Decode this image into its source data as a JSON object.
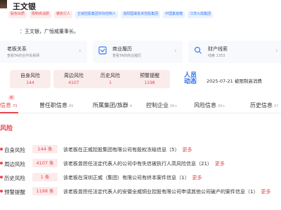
{
  "header": {
    "name": "王文银",
    "tags": [
      {
        "label": "股权出质",
        "style": "red"
      },
      {
        "label": "限制高消费",
        "style": "red"
      },
      {
        "label": "被执行人",
        "style": "red"
      },
      {
        "label": "正威控股集团实际控制人",
        "style": "blue"
      },
      {
        "label": "洛阳国晟投资控股集团",
        "style": "blue"
      },
      {
        "label": "中国集装箱",
        "style": "blue"
      },
      {
        "label": "江苏九鼎集团",
        "style": "blue"
      }
    ]
  },
  "intro": "：王文银，广恒威董事长。",
  "cards": [
    {
      "title": "老板关系",
      "sub": "查看TA的合作关系网"
    },
    {
      "title": "商业履历",
      "sub": "查看TA的商业履历"
    },
    {
      "title": "财产线索",
      "sub": "线索 1353"
    }
  ],
  "risk_summary": [
    {
      "label": "自身风险",
      "value": "144"
    },
    {
      "label": "周边风险",
      "value": "4107"
    },
    {
      "label": "历史风险",
      "value": "1"
    },
    {
      "label": "预警提醒",
      "value": "1198"
    }
  ],
  "dynamic": {
    "label": "人员动态",
    "text": "2025-07-21 被限制高消费"
  },
  "tabs": [
    {
      "label": "信息",
      "count": "73"
    },
    {
      "label": "曾任职信息",
      "count": "89"
    },
    {
      "label": "所属集团/族群",
      "count": "4"
    },
    {
      "label": "控制企业",
      "count": "99+"
    },
    {
      "label": "风险信息",
      "count": "99+"
    },
    {
      "label": "历史信息",
      "count": "47"
    }
  ],
  "tab_badge": "新",
  "section_title": "风险",
  "risk_items": [
    {
      "label": "自身风险",
      "value": "144 条",
      "desc": "该老板在正威控股集团有限公司有股权冻结信息（5）",
      "more": "更多"
    },
    {
      "label": "周边风险",
      "value": "4107 条",
      "desc": "该老板曾担任法定代表人的公司中有失信被执行人高风险信息（21）",
      "more": "更多"
    },
    {
      "label": "历史风险",
      "value": "1 条",
      "desc": "该老板在深圳正威（集团）有限公司有终本案件信息（1）",
      "more": "更多"
    },
    {
      "label": "预警提醒",
      "value": "1198 条",
      "desc": "该老板曾担任法定代表人的安徽全威铜业控股有限公司申请其他公司破产的案件信息（1）",
      "more": "更多"
    }
  ]
}
